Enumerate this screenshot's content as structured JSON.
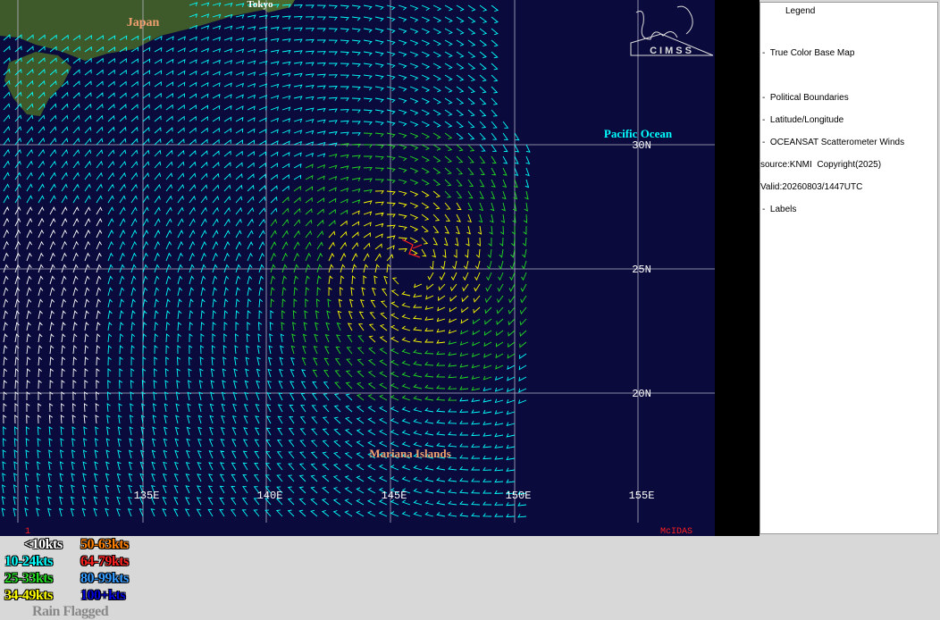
{
  "map": {
    "labels": {
      "japan": "Japan",
      "tokyo": "Tokyo",
      "pacific": "Pacific Ocean",
      "mariana": "Mariana Islands"
    },
    "lat_labels": [
      "30N",
      "25N",
      "20N"
    ],
    "lon_labels": [
      "135E",
      "140E",
      "145E",
      "150E",
      "155E"
    ],
    "corner_number": "1",
    "mcidas": "McIDAS",
    "logo_text": "CIMSS",
    "colors": {
      "ocean": "#0a0a3c",
      "land": "#3f5a2a",
      "grid": "#b4b4c8",
      "lt10": "#ffffff",
      "k10_24": "#00ffff",
      "k25_33": "#22dd22",
      "k34_49": "#ffff00",
      "k50_63": "#ff8000",
      "k64_79": "#ff2020"
    }
  },
  "legend": {
    "title": "Legend",
    "items": [
      "True Color Base Map",
      "Political Boundaries",
      "Latitude/Longitude",
      "OCEANSAT Scatterometer Winds"
    ],
    "source": "source:KNMI  Copyright(2025)",
    "valid": "Valid:20260803/1447UTC",
    "labels_item": "Labels"
  },
  "speed_key": [
    {
      "label": "<10kts",
      "color": "#ffffff"
    },
    {
      "label": "50-63kts",
      "color": "#ff8000"
    },
    {
      "label": "10-24kts",
      "color": "#00ffff"
    },
    {
      "label": "64-79kts",
      "color": "#ff2020"
    },
    {
      "label": "25-33kts",
      "color": "#22dd22"
    },
    {
      "label": "80-99kts",
      "color": "#3399ff"
    },
    {
      "label": "34-49kts",
      "color": "#ffff00"
    },
    {
      "label": "100+kts",
      "color": "#0000dd"
    },
    {
      "label": "Rain Flagged",
      "color": "#888888"
    }
  ]
}
